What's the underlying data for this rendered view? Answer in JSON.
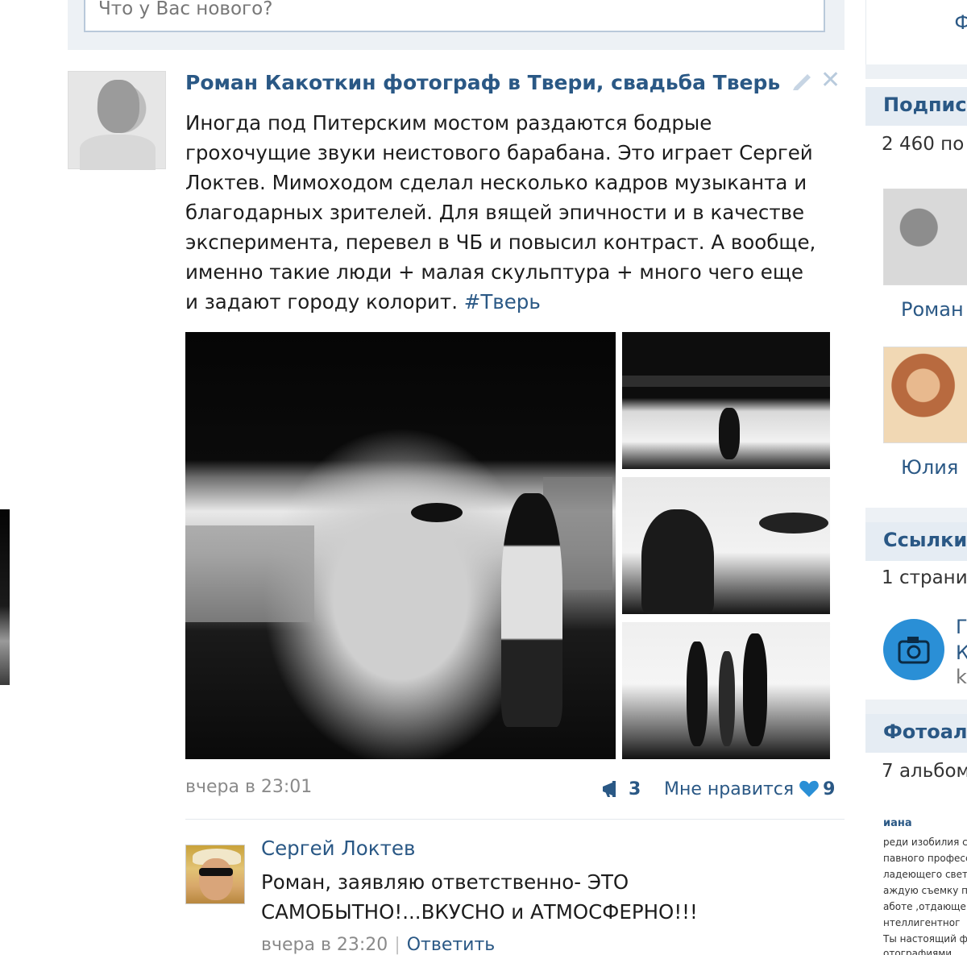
{
  "composer": {
    "placeholder": "Что у Вас нового?"
  },
  "post": {
    "author": "Роман Какоткин фотограф в Твери, свадьба Тверь",
    "text": "Иногда под Питерским мостом раздаются бодрые грохочущие звуки неистового барабана. Это играет Сергей Локтев. Мимоходом сделал несколько кадров музыканта и благодарных зрителей. Для вящей эпичности и в качестве эксперимента, перевел в ЧБ и повысил контраст. А вообще, именно такие люди + малая скульптура + много чего еще и задают городу колорит.",
    "hashtag": "#Тверь",
    "date": "вчера в 23:01",
    "share_count": "3",
    "like_label": "Мне нравится",
    "like_count": "9",
    "icons": {
      "edit": "pencil-icon",
      "delete": "close-icon",
      "share": "megaphone-icon",
      "like": "heart-icon"
    },
    "close_glyph": "✕"
  },
  "comment": {
    "author": "Сергей Локтев",
    "text": "Роман, заявляю ответственно- ЭТО САМОБЫТНО!...ВКУСНО и АТМОСФЕРНО!!!",
    "date": "вчера в 23:20",
    "separator": "|",
    "reply_label": "Ответить"
  },
  "sidebar": {
    "top_fragment": "Ф",
    "subscribers": {
      "title": "Подпис",
      "count_text": "2 460 по",
      "people": [
        "Роман",
        "Юлия"
      ]
    },
    "links": {
      "title": "Ссылки",
      "count_text": "1 страни",
      "letters": [
        "Г",
        "К",
        "k"
      ]
    },
    "albums": {
      "title": "Фотоал",
      "count_text": "7 альбом"
    },
    "about": {
      "title": "иана",
      "lines": [
        "реди изобилия с",
        "павного професс",
        "ладеющего свет",
        "аждую съемку п",
        "аботе ,отдающе",
        "нтеллигентног",
        "Ты настоящий ф",
        "отографиями ,"
      ]
    }
  },
  "colors": {
    "link": "#2a5885",
    "header_bg": "#e5ecf3",
    "page_bg": "#edf1f5"
  }
}
